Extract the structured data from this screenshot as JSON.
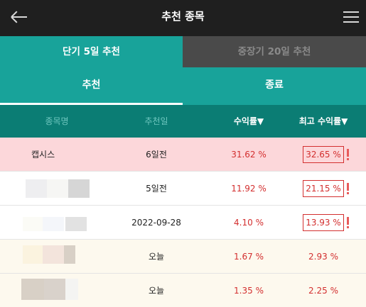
{
  "header": {
    "title": "추천 종목",
    "back_icon": "back-arrow-icon",
    "menu_icon": "hamburger-menu-icon"
  },
  "period_tabs": [
    {
      "label": "단기 5일 추천",
      "active": true
    },
    {
      "label": "중장기 20일 추천",
      "active": false
    }
  ],
  "status_tabs": [
    {
      "label": "추천",
      "active": true
    },
    {
      "label": "종료",
      "active": false
    }
  ],
  "table": {
    "headers": {
      "name": "종목명",
      "date": "추천일",
      "return": "수익률▼",
      "max_return": "최고 수익률▼"
    },
    "rows": [
      {
        "name": "캡시스",
        "date": "6일전",
        "return": "31.62 %",
        "max_return": "32.65 %",
        "highlight": true,
        "boxed": true,
        "alert": true
      },
      {
        "name": "",
        "date": "5일전",
        "return": "11.92 %",
        "max_return": "21.15 %",
        "highlight": false,
        "boxed": true,
        "alert": true
      },
      {
        "name": "",
        "date": "2022-09-28",
        "return": "4.10 %",
        "max_return": "13.93 %",
        "highlight": false,
        "boxed": true,
        "alert": true
      },
      {
        "name": "",
        "date": "오늘",
        "return": "1.67 %",
        "max_return": "2.93 %",
        "highlight": false,
        "boxed": false,
        "alert": false
      },
      {
        "name": "",
        "date": "오늘",
        "return": "1.35 %",
        "max_return": "2.25 %",
        "highlight": false,
        "boxed": false,
        "alert": false
      }
    ]
  },
  "colors": {
    "teal": "#18a39a",
    "teal_dark": "#0b7d74",
    "highlight_row": "#fcd7da",
    "today_row": "#fdf9ee",
    "positive": "#d32f2f"
  }
}
